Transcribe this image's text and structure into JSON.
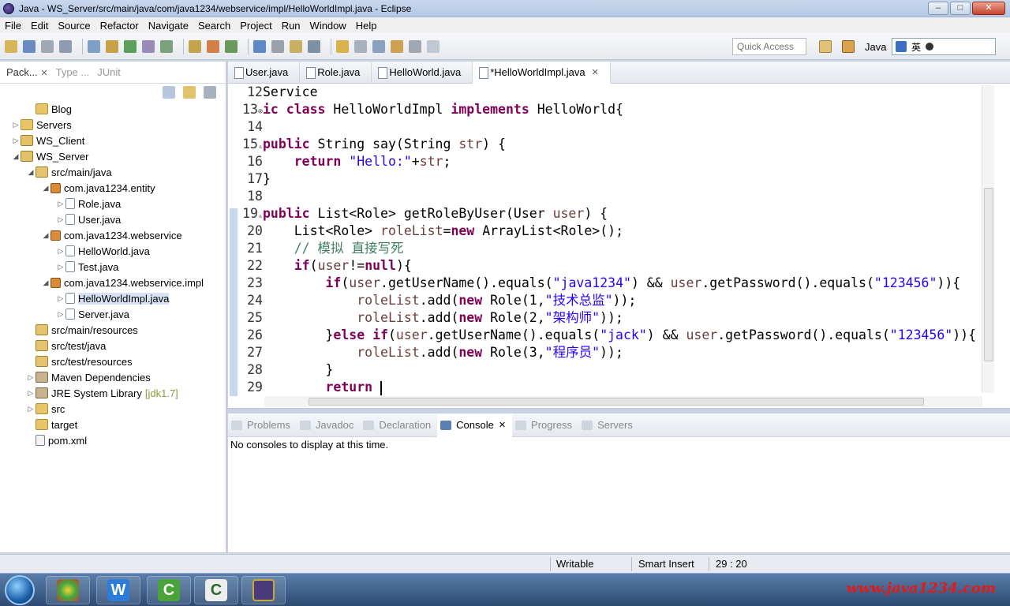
{
  "window": {
    "title": "Java - WS_Server/src/main/java/com/java1234/webservice/impl/HelloWorldImpl.java - Eclipse",
    "min_glyph": "–",
    "max_glyph": "□",
    "close_glyph": "✕"
  },
  "menu": [
    "File",
    "Edit",
    "Source",
    "Refactor",
    "Navigate",
    "Search",
    "Project",
    "Run",
    "Window",
    "Help"
  ],
  "toolbar": {
    "quick_access_placeholder": "Quick Access",
    "perspective_label": "Java",
    "ime_label": "英"
  },
  "explorer": {
    "tabs": [
      {
        "label": "Pack..."
      },
      {
        "label": "Type ..."
      },
      {
        "label": "JUnit"
      }
    ],
    "tree": [
      {
        "label": "Blog",
        "icon": "folder",
        "depth": 1,
        "arrow": ""
      },
      {
        "label": "Servers",
        "icon": "folder",
        "depth": 0,
        "arrow": "▷"
      },
      {
        "label": "WS_Client",
        "icon": "project",
        "depth": 0,
        "arrow": "▷"
      },
      {
        "label": "WS_Server",
        "icon": "project",
        "depth": 0,
        "arrow": "◢"
      },
      {
        "label": "src/main/java",
        "icon": "src",
        "depth": 1,
        "arrow": "◢"
      },
      {
        "label": "com.java1234.entity",
        "icon": "pkg",
        "depth": 2,
        "arrow": "◢"
      },
      {
        "label": "Role.java",
        "icon": "java",
        "depth": 3,
        "arrow": "▷"
      },
      {
        "label": "User.java",
        "icon": "java",
        "depth": 3,
        "arrow": "▷"
      },
      {
        "label": "com.java1234.webservice",
        "icon": "pkg",
        "depth": 2,
        "arrow": "◢"
      },
      {
        "label": "HelloWorld.java",
        "icon": "java",
        "depth": 3,
        "arrow": "▷"
      },
      {
        "label": "Test.java",
        "icon": "java",
        "depth": 3,
        "arrow": "▷"
      },
      {
        "label": "com.java1234.webservice.impl",
        "icon": "pkg",
        "depth": 2,
        "arrow": "◢"
      },
      {
        "label": "HelloWorldImpl.java",
        "icon": "java",
        "depth": 3,
        "arrow": "▷",
        "selected": true
      },
      {
        "label": "Server.java",
        "icon": "java",
        "depth": 3,
        "arrow": "▷"
      },
      {
        "label": "src/main/resources",
        "icon": "src",
        "depth": 1,
        "arrow": ""
      },
      {
        "label": "src/test/java",
        "icon": "src",
        "depth": 1,
        "arrow": ""
      },
      {
        "label": "src/test/resources",
        "icon": "src",
        "depth": 1,
        "arrow": ""
      },
      {
        "label": "Maven Dependencies",
        "icon": "lib",
        "depth": 1,
        "arrow": "▷"
      },
      {
        "label": "JRE System Library",
        "suffix": "[jdk1.7]",
        "icon": "lib",
        "depth": 1,
        "arrow": "▷"
      },
      {
        "label": "src",
        "icon": "folder",
        "depth": 1,
        "arrow": "▷"
      },
      {
        "label": "target",
        "icon": "folder",
        "depth": 1,
        "arrow": ""
      },
      {
        "label": "pom.xml",
        "icon": "xml",
        "depth": 1,
        "arrow": ""
      }
    ]
  },
  "editor": {
    "tabs": [
      {
        "label": "User.java",
        "active": false
      },
      {
        "label": "Role.java",
        "active": false
      },
      {
        "label": "HelloWorld.java",
        "active": false
      },
      {
        "label": "*HelloWorldImpl.java",
        "active": true,
        "close": "✕"
      }
    ],
    "lines": [
      {
        "n": "12",
        "marker": "",
        "parts": [
          [
            "",
            "Service"
          ]
        ]
      },
      {
        "n": "13",
        "marker": "⊗",
        "parts": [
          [
            "kw",
            "ic class "
          ],
          [
            "",
            "HelloWorldImpl "
          ],
          [
            "kw",
            "implements "
          ],
          [
            "",
            "HelloWorld{"
          ]
        ]
      },
      {
        "n": "14",
        "marker": "",
        "parts": []
      },
      {
        "n": "15",
        "marker": "▵",
        "parts": [
          [
            "kw",
            "public "
          ],
          [
            "",
            "String say(String "
          ],
          [
            "fld",
            "str"
          ],
          [
            "",
            ") {"
          ]
        ]
      },
      {
        "n": "16",
        "marker": "",
        "parts": [
          [
            "",
            "    "
          ],
          [
            "kw",
            "return "
          ],
          [
            "str",
            "\"Hello:\""
          ],
          [
            "",
            "+"
          ],
          [
            "fld",
            "str"
          ],
          [
            "",
            ";"
          ]
        ]
      },
      {
        "n": "17",
        "marker": "",
        "parts": [
          [
            "",
            "}"
          ]
        ]
      },
      {
        "n": "18",
        "marker": "",
        "parts": []
      },
      {
        "n": "19",
        "marker": "▵",
        "parts": [
          [
            "kw",
            "public "
          ],
          [
            "",
            "List<Role> getRoleByUser(User "
          ],
          [
            "fld",
            "user"
          ],
          [
            "",
            ") {"
          ]
        ]
      },
      {
        "n": "20",
        "marker": "",
        "parts": [
          [
            "",
            "    List<Role> "
          ],
          [
            "fld",
            "roleList"
          ],
          [
            "",
            "="
          ],
          [
            "kw",
            "new "
          ],
          [
            "",
            "ArrayList<Role>();"
          ]
        ]
      },
      {
        "n": "21",
        "marker": "",
        "parts": [
          [
            "",
            "    "
          ],
          [
            "cmt",
            "// 模拟 直接写死"
          ]
        ]
      },
      {
        "n": "22",
        "marker": "",
        "parts": [
          [
            "",
            "    "
          ],
          [
            "kw",
            "if"
          ],
          [
            "",
            "("
          ],
          [
            "fld",
            "user"
          ],
          [
            "",
            "!="
          ],
          [
            "kw",
            "null"
          ],
          [
            "",
            "){"
          ]
        ]
      },
      {
        "n": "23",
        "marker": "",
        "parts": [
          [
            "",
            "        "
          ],
          [
            "kw",
            "if"
          ],
          [
            "",
            "("
          ],
          [
            "fld",
            "user"
          ],
          [
            "",
            ".getUserName().equals("
          ],
          [
            "str",
            "\"java1234\""
          ],
          [
            "",
            ") && "
          ],
          [
            "fld",
            "user"
          ],
          [
            "",
            ".getPassword().equals("
          ],
          [
            "str",
            "\"123456\""
          ],
          [
            "",
            ")){"
          ]
        ]
      },
      {
        "n": "24",
        "marker": "",
        "parts": [
          [
            "",
            "            "
          ],
          [
            "fld",
            "roleList"
          ],
          [
            "",
            ".add("
          ],
          [
            "kw",
            "new "
          ],
          [
            "",
            "Role(1,"
          ],
          [
            "str",
            "\"技术总监\""
          ],
          [
            "",
            "));"
          ]
        ]
      },
      {
        "n": "25",
        "marker": "",
        "parts": [
          [
            "",
            "            "
          ],
          [
            "fld",
            "roleList"
          ],
          [
            "",
            ".add("
          ],
          [
            "kw",
            "new "
          ],
          [
            "",
            "Role(2,"
          ],
          [
            "str",
            "\"架构师\""
          ],
          [
            "",
            "));"
          ]
        ]
      },
      {
        "n": "26",
        "marker": "",
        "parts": [
          [
            "",
            "        }"
          ],
          [
            "kw",
            "else if"
          ],
          [
            "",
            "("
          ],
          [
            "fld",
            "user"
          ],
          [
            "",
            ".getUserName().equals("
          ],
          [
            "str",
            "\"jack\""
          ],
          [
            "",
            ") && "
          ],
          [
            "fld",
            "user"
          ],
          [
            "",
            ".getPassword().equals("
          ],
          [
            "str",
            "\"123456\""
          ],
          [
            "",
            ")){"
          ]
        ]
      },
      {
        "n": "27",
        "marker": "",
        "parts": [
          [
            "",
            "            "
          ],
          [
            "fld",
            "roleList"
          ],
          [
            "",
            ".add("
          ],
          [
            "kw",
            "new "
          ],
          [
            "",
            "Role(3,"
          ],
          [
            "str",
            "\"程序员\""
          ],
          [
            "",
            "));"
          ]
        ]
      },
      {
        "n": "28",
        "marker": "",
        "parts": [
          [
            "",
            "        }"
          ]
        ]
      },
      {
        "n": "29",
        "marker": "",
        "parts": [
          [
            "",
            "        "
          ],
          [
            "kw",
            "return "
          ]
        ],
        "caret": true
      }
    ]
  },
  "console_panel": {
    "tabs": [
      {
        "label": "Problems",
        "active": false
      },
      {
        "label": "Javadoc",
        "active": false
      },
      {
        "label": "Declaration",
        "active": false
      },
      {
        "label": "Console",
        "active": true,
        "close": "✕"
      },
      {
        "label": "Progress",
        "active": false
      },
      {
        "label": "Servers",
        "active": false
      }
    ],
    "message": "No consoles to display at this time."
  },
  "status": {
    "writable": "Writable",
    "insert_mode": "Smart Insert",
    "position": "29 : 20"
  },
  "taskbar": {
    "watermark": "www.java1234.com"
  },
  "colors": {
    "keyword": "#7f0055",
    "string": "#2a00ff",
    "field": "#6a3e3e",
    "comment": "#3f7f5f"
  }
}
